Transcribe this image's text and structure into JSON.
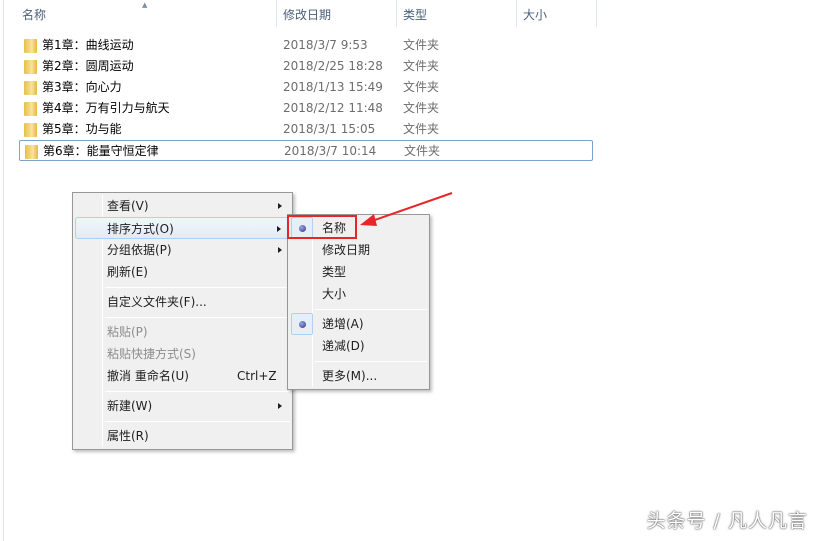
{
  "columns": [
    "名称",
    "修改日期",
    "类型",
    "大小"
  ],
  "files": [
    {
      "name": "第1章：曲线运动",
      "date": "2018/3/7 9:53",
      "type": "文件夹"
    },
    {
      "name": "第2章：圆周运动",
      "date": "2018/2/25 18:28",
      "type": "文件夹"
    },
    {
      "name": "第3章：向心力",
      "date": "2018/1/13 15:49",
      "type": "文件夹"
    },
    {
      "name": "第4章：万有引力与航天",
      "date": "2018/2/12 11:48",
      "type": "文件夹"
    },
    {
      "name": "第5章：功与能",
      "date": "2018/3/1 15:05",
      "type": "文件夹"
    },
    {
      "name": "第6章：能量守恒定律",
      "date": "2018/3/7 10:14",
      "type": "文件夹"
    }
  ],
  "context_menu": {
    "view": "查看(V)",
    "sort": "排序方式(O)",
    "group": "分组依据(P)",
    "refresh": "刷新(E)",
    "customize": "自定义文件夹(F)...",
    "paste": "粘贴(P)",
    "paste_shortcut": "粘贴快捷方式(S)",
    "undo": "撤消 重命名(U)",
    "undo_shortcut": "Ctrl+Z",
    "new": "新建(W)",
    "properties": "属性(R)"
  },
  "sort_submenu": {
    "name": "名称",
    "date": "修改日期",
    "type": "类型",
    "size": "大小",
    "asc": "递增(A)",
    "desc": "递减(D)",
    "more": "更多(M)...",
    "selected_field": "名称",
    "selected_order": "递增(A)"
  },
  "annotation_color": "#e8262a",
  "watermark": "头条号 / 凡人凡言"
}
